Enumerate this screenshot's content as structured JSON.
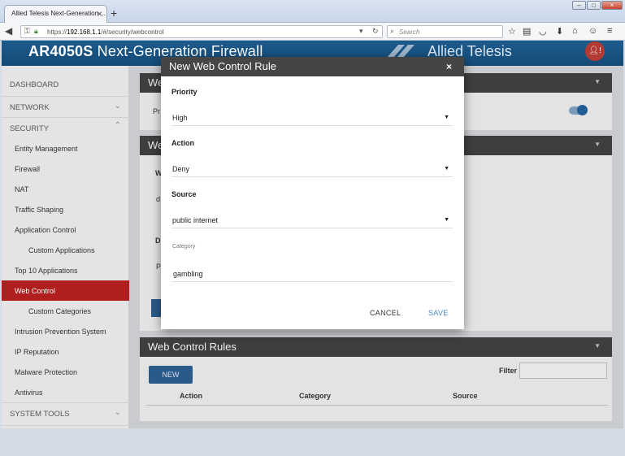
{
  "browser": {
    "tab_title": "Allied Telesis Next-Generation ...",
    "tab_close": "×",
    "new_tab": "+",
    "url_prefix": "https://",
    "url_host": "192.168.1.1",
    "url_path": "/#/security/webcontrol",
    "search_placeholder": "Search"
  },
  "app": {
    "product_name": "AR4050S",
    "product_suffix": "Next-Generation Firewall",
    "brand_name": "Allied Telesis",
    "user_badge": "!"
  },
  "sidebar": {
    "items": [
      {
        "label": "DASHBOARD"
      },
      {
        "label": "NETWORK"
      },
      {
        "label": "SECURITY"
      },
      {
        "label": "Entity Management"
      },
      {
        "label": "Firewall"
      },
      {
        "label": "NAT"
      },
      {
        "label": "Traffic Shaping"
      },
      {
        "label": "Application Control"
      },
      {
        "label": "Custom Applications"
      },
      {
        "label": "Top 10 Applications"
      },
      {
        "label": "Web Control"
      },
      {
        "label": "Custom Categories"
      },
      {
        "label": "Intrusion Prevention System"
      },
      {
        "label": "IP Reputation"
      },
      {
        "label": "Malware Protection"
      },
      {
        "label": "Antivirus"
      },
      {
        "label": "SYSTEM TOOLS"
      }
    ]
  },
  "main": {
    "panel1_title": "We",
    "panel1_frag": "Pr",
    "panel2_title": "We",
    "frag_w": "W",
    "frag_d": "d",
    "frag_D": "D",
    "frag_P": "P",
    "rules_title": "Web Control Rules",
    "new_button": "NEW",
    "filter_label": "Filter",
    "columns": [
      "Action",
      "Category",
      "Source"
    ]
  },
  "modal": {
    "title": "New Web Control Rule",
    "close": "×",
    "priority_label": "Priority",
    "priority_value": "High",
    "action_label": "Action",
    "action_value": "Deny",
    "source_label": "Source",
    "source_value": "public internet",
    "category_label": "Category",
    "category_value": "gambling",
    "cancel_label": "CANCEL",
    "save_label": "SAVE"
  },
  "colors": {
    "header_blue": "#1d5b8d",
    "active_red": "#b01e1e",
    "panel_dark": "#3e3e3e",
    "save_blue": "#4a86c5"
  }
}
